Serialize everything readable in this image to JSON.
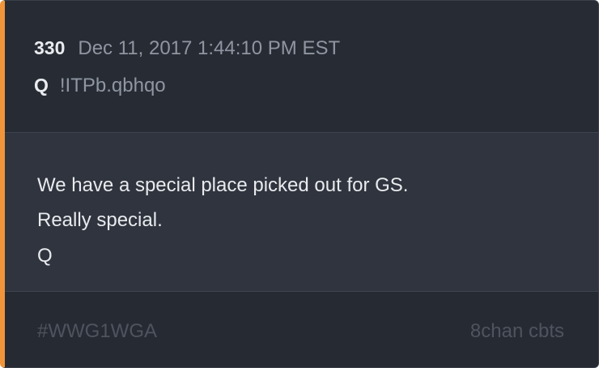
{
  "post": {
    "number": "330",
    "date": "Dec 11, 2017 1:44:10 PM EST",
    "author": "Q",
    "tripcode": "!ITPb.qbhqo",
    "lines": [
      "We have a special place picked out for GS.",
      "Really special.",
      "Q"
    ],
    "hashtag": "#WWG1WGA",
    "source": "8chan cbts"
  },
  "colors": {
    "accent_bar": "#f0953a",
    "card_background": "#262a33",
    "body_background": "#2f343e"
  }
}
